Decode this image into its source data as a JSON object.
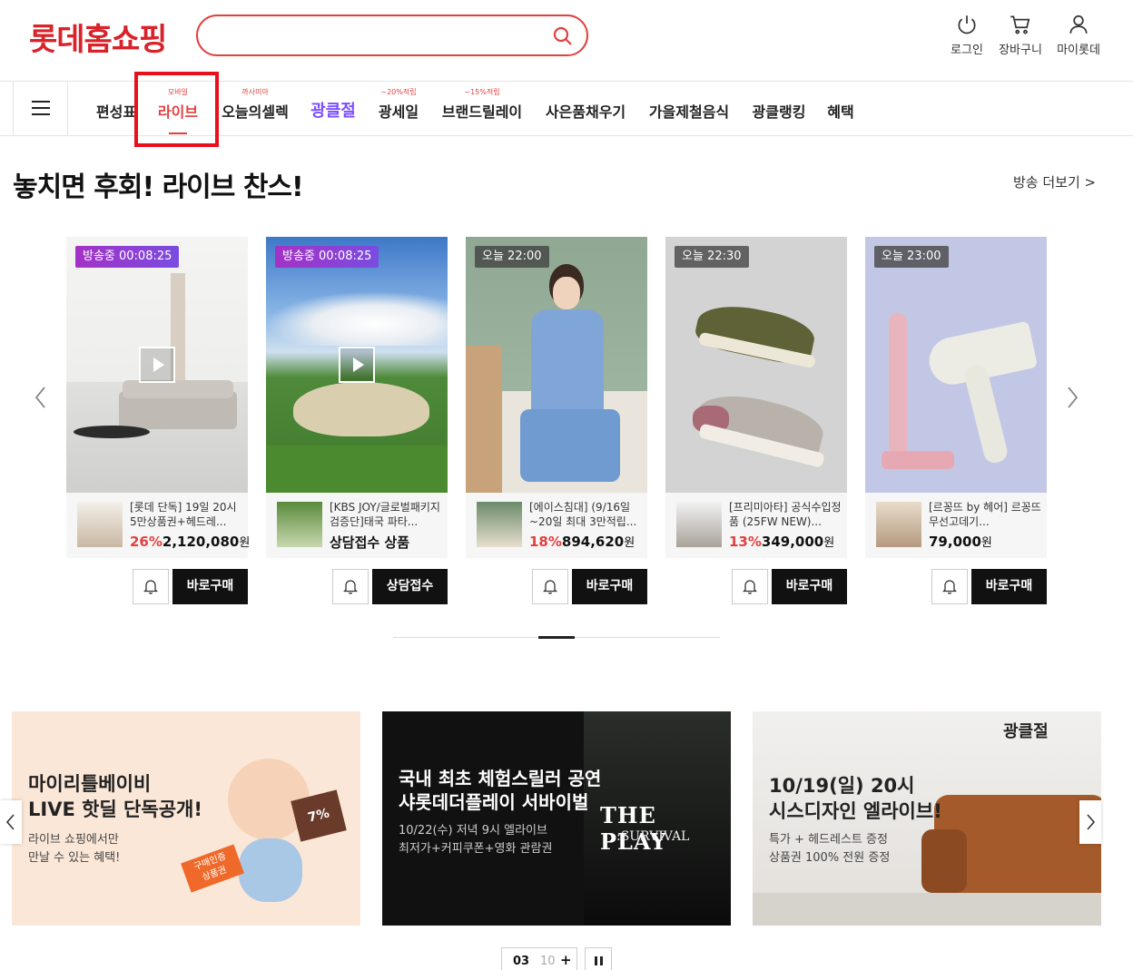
{
  "header": {
    "logo": "롯데홈쇼핑",
    "search_value": "",
    "utils": [
      {
        "label": "로그인",
        "icon": "power-icon"
      },
      {
        "label": "장바구니",
        "icon": "cart-icon"
      },
      {
        "label": "마이롯데",
        "icon": "user-icon"
      }
    ]
  },
  "nav": {
    "items": [
      {
        "label": "편성표",
        "tag": ""
      },
      {
        "label": "라이브",
        "tag": "모바일"
      },
      {
        "label": "오늘의셀렉",
        "tag": "까사미아"
      },
      {
        "label": "광클절",
        "tag": ""
      },
      {
        "label": "광세일",
        "tag": "~20%적립"
      },
      {
        "label": "브랜드릴레이",
        "tag": "~15%적립"
      },
      {
        "label": "사은품채우기",
        "tag": ""
      },
      {
        "label": "가을제철음식",
        "tag": ""
      },
      {
        "label": "광클랭킹",
        "tag": ""
      },
      {
        "label": "혜택",
        "tag": ""
      }
    ],
    "active_color": "#e2403f"
  },
  "live": {
    "title": "놓치면 후회! 라이브 찬스!",
    "more": "방송 더보기 >",
    "cards": [
      {
        "badge": "방송중 00:08:25",
        "name": "[롯데 단독] 19일 20시 5만상품권+헤드레...",
        "rate": "26%",
        "price": "2,120,080",
        "won": "원",
        "button": "바로구매"
      },
      {
        "badge": "방송중 00:08:25",
        "name": "[KBS JOY/글로벌패키지검증단]태국 파타...",
        "rate": "",
        "price": "상담접수 상품",
        "won": "",
        "button": "상담접수"
      },
      {
        "badge": "오늘 22:00",
        "name": "[에이스침대] (9/16일~20일 최대 3만적립...",
        "rate": "18%",
        "price": "894,620",
        "won": "원",
        "button": "바로구매"
      },
      {
        "badge": "오늘 22:30",
        "name": "[프리미아타] 공식수입정품 (25FW NEW)...",
        "rate": "13%",
        "price": "349,000",
        "won": "원",
        "button": "바로구매"
      },
      {
        "badge": "오늘 23:00",
        "name": "[르꽁뜨 by 헤어] 르꽁뜨 무선고데기...",
        "rate": "",
        "price": "79,000",
        "won": "원",
        "button": "바로구매"
      }
    ]
  },
  "banners": [
    {
      "line1": "마이리틀베이비",
      "line2": "LIVE 핫딜 단독공개!",
      "sub1": "라이브 쇼핑에서만",
      "sub2": "만날 수 있는 혜택!",
      "chip1": "구매인증",
      "chip2": "상품권",
      "badge": "7%"
    },
    {
      "line1": "국내 최초 체험스릴러 공연",
      "line2": "샤롯데더플레이 서바이벌",
      "sub1": "10/22(수) 저녁 9시 엘라이브",
      "sub2": "최저가+커피쿠폰+영화 관람권",
      "poster": "THE PLAY",
      "poster_sub": ":SURVIVAL"
    },
    {
      "line1": "10/19(일) 20시",
      "line2": "시스디자인 엘라이브!",
      "sub1": "특가 + 헤드레스트 증정",
      "sub2": "상품권 100% 전원 증정",
      "brand": "광클절"
    }
  ],
  "pager": {
    "current": "03",
    "total": "10",
    "plus": "+"
  }
}
